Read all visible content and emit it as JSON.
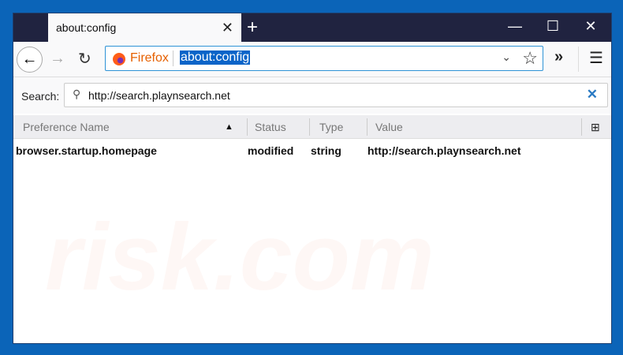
{
  "tab": {
    "title": "about:config",
    "close": "✕",
    "new_tab": "+"
  },
  "window_controls": {
    "minimize": "—",
    "maximize": "☐",
    "close": "✕"
  },
  "toolbar": {
    "back": "←",
    "forward": "→",
    "reload": "↻",
    "identity": "Firefox",
    "url": "about:config",
    "dropdown": "⌄",
    "bookmark": "☆",
    "overflow": "»",
    "menu": "☰"
  },
  "search": {
    "label": "Search:",
    "value": "http://search.playnsearch.net",
    "clear": "✕",
    "icon": "⚲"
  },
  "columns": {
    "name": "Preference Name",
    "sort": "▲",
    "status": "Status",
    "type": "Type",
    "value": "Value",
    "picker": "⊞"
  },
  "rows": [
    {
      "name": "browser.startup.homepage",
      "status": "modified",
      "type": "string",
      "value": "http://search.playnsearch.net"
    }
  ],
  "watermark": "risk.com"
}
